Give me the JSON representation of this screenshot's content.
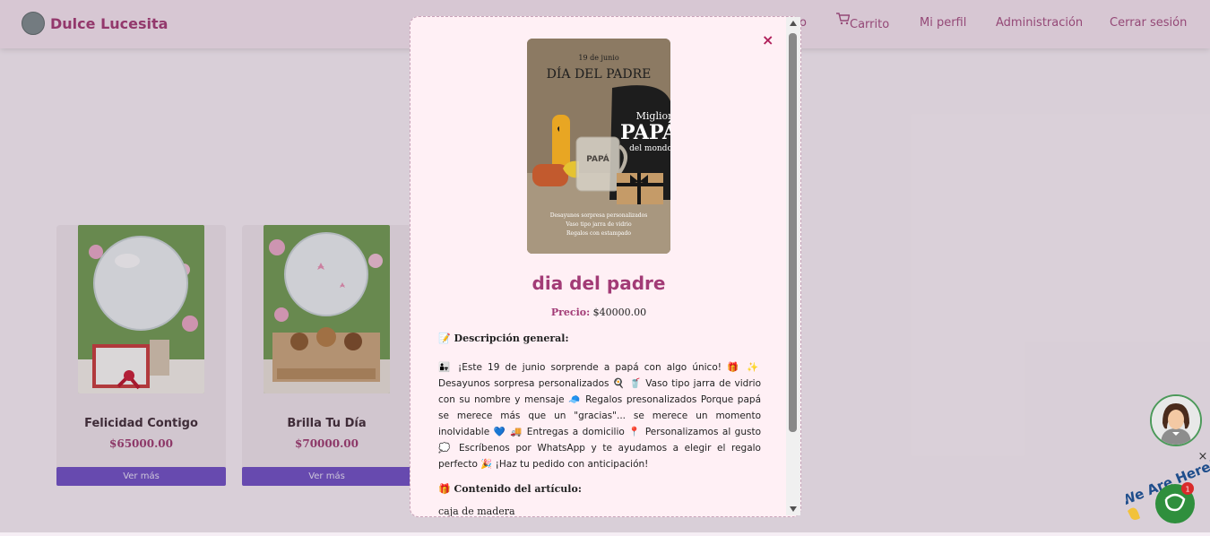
{
  "brand": {
    "name": "Dulce Lucesita"
  },
  "nav": {
    "partial": "o",
    "cart": "Carrito",
    "profile": "Mi perfil",
    "admin": "Administración",
    "logout": "Cerrar sesión"
  },
  "cards": [
    {
      "title": "Felicidad Contigo",
      "price": "$65000.00",
      "button": "Ver más"
    },
    {
      "title": "Brilla Tu Día",
      "price": "$70000.00",
      "button": "Ver más"
    }
  ],
  "modal": {
    "close": "×",
    "image_text": {
      "date": "19 de junio",
      "headline": "DÍA DEL PADRE",
      "mug": "PAPÁ",
      "shirt_top": "Miglior",
      "shirt_main": "PAPÁ",
      "shirt_bottom": "del mondo",
      "caption1": "Desayunos sorpresa personalizados",
      "caption2": "Vaso tipo jarra de vidrio",
      "caption3": "Regalos con estampado"
    },
    "title": "dia del padre",
    "price_label": "Precio:",
    "price_value": "$40000.00",
    "description_heading": "📝 Descripción general:",
    "description": "👨‍👧 ¡Este 19 de junio sorprende a papá con algo único! 🎁 ✨ Desayunos sorpresa personalizados 🍳 🥤 Vaso tipo jarra de vidrio con su nombre y mensaje 🧢 Regalos presonalizados Porque papá se merece más que un \"gracias\"... se merece un momento inolvidable 💙 🚚 Entregas a domicilio 📍 Personalizamos al gusto 💭 Escríbenos por WhatsApp y te ayudamos a elegir el regalo perfecto 🎉 ¡Haz tu pedido con anticipación!",
    "contents_heading": "🎁 Contenido del artículo:",
    "contents_first": "caja de madera"
  },
  "chat": {
    "badge": "1",
    "tagline": "We Are Here!",
    "close": "×"
  },
  "colors": {
    "brand": "#a33a74",
    "button": "#6e4fc4",
    "modal_bg": "#fff0f5"
  }
}
